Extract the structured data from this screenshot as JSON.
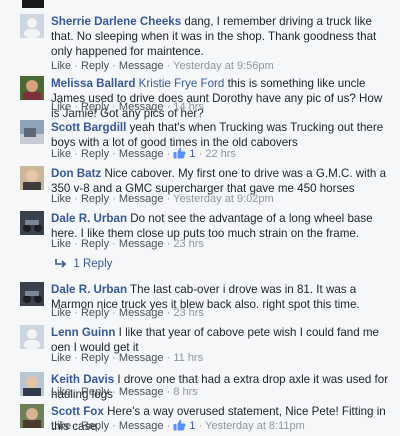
{
  "actions": {
    "like": "Like",
    "reply": "Reply",
    "message": "Message",
    "sep": "·"
  },
  "reply_toggle": {
    "label": "1 Reply"
  },
  "comments": [
    {
      "author": "Sherrie Darlene Cheeks",
      "tag": "",
      "text": "dang, I remember driving a truck like that. No sleeping when it was in the shop. Thank goodness that only happened for maintence.",
      "time": "Yesterday at 9:56pm",
      "likes": ""
    },
    {
      "author": "Melissa Ballard",
      "tag": "Kristie Frye Ford",
      "text": "this is something like uncle James used to drive does aunt Dorothy have any pic of us? How is Jamie! Got any pics of her?",
      "time": "14 hrs",
      "likes": ""
    },
    {
      "author": "Scott Bargdill",
      "tag": "",
      "text": "yeah that's when Trucking was Trucking out there boys with a lot of good times in the old cabovers",
      "time": "22 hrs",
      "likes": "1"
    },
    {
      "author": "Don Batz",
      "tag": "",
      "text": "Nice cabover. My first one to drive was a G.M.C. with a 350 v-8 and a GMC supercharger that gave me 450 horses",
      "time": "Yesterday at 9:02pm",
      "likes": ""
    },
    {
      "author": "Dale R. Urban",
      "tag": "",
      "text": "Do not see the advantage of a long wheel base here. I like them close up puts too much strain on the frame.",
      "time": "23 hrs",
      "likes": ""
    },
    {
      "author": "Dale R. Urban",
      "tag": "",
      "text": "The last cab-over i drove was in 81. It was a Marmon nice truck yes it blew back also. right spot this time.",
      "time": "23 hrs",
      "likes": ""
    },
    {
      "author": "Lenn Guinn",
      "tag": "",
      "text": "I like that year of cabove pete wish I could fand me oen I would get it",
      "time": "11 hrs",
      "likes": ""
    },
    {
      "author": "Keith Davis",
      "tag": "",
      "text": "I drove one that had a extra drop axle it was used for hauling logs",
      "time": "8 hrs",
      "likes": ""
    },
    {
      "author": "Scott Fox",
      "tag": "",
      "text": "Here's a way overused statement, Nice Pete! Fitting in this case.",
      "time": "Yesterday at 8:11pm",
      "likes": "1"
    }
  ]
}
